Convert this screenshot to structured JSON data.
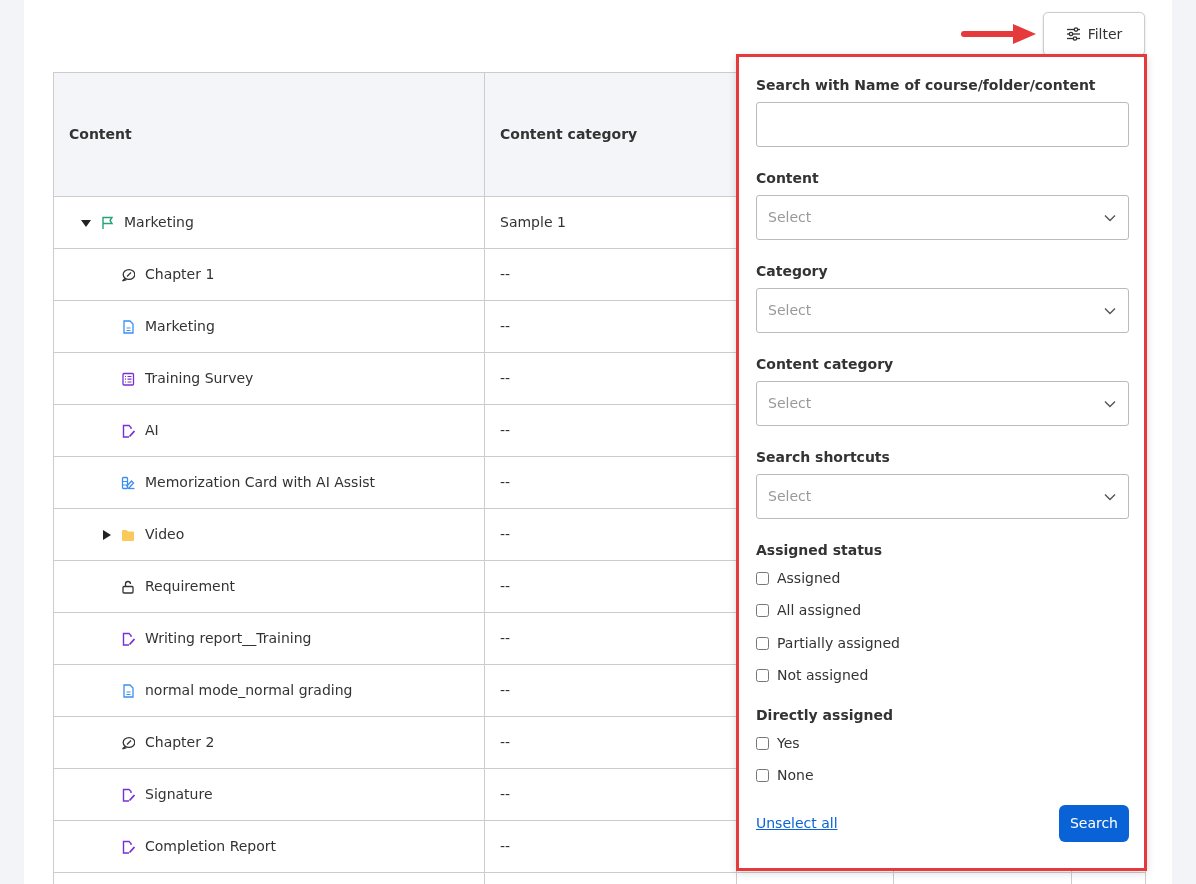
{
  "filter_button": {
    "label": "Filter"
  },
  "table": {
    "columns": [
      "Content",
      "Content category"
    ],
    "rows": [
      {
        "name": "Marketing",
        "kind": "course",
        "category": "Sample 1",
        "expanded": true,
        "children": [
          {
            "name": "Chapter 1",
            "kind": "chapter",
            "category": "--"
          },
          {
            "name": "Marketing",
            "kind": "document",
            "category": "--"
          },
          {
            "name": "Training Survey",
            "kind": "survey",
            "category": "--"
          },
          {
            "name": "AI",
            "kind": "report",
            "category": "--"
          },
          {
            "name": "Memorization Card with AI Assist",
            "kind": "card",
            "category": "--"
          },
          {
            "name": "Video",
            "kind": "folder",
            "category": "--",
            "expanded": false
          },
          {
            "name": "Requirement",
            "kind": "requirement",
            "category": "--"
          },
          {
            "name": "Writing report__Training",
            "kind": "report",
            "category": "--"
          },
          {
            "name": "normal mode_normal grading",
            "kind": "document",
            "category": "--"
          },
          {
            "name": "Chapter 2",
            "kind": "chapter",
            "category": "--"
          },
          {
            "name": "Signature",
            "kind": "report",
            "category": "--"
          },
          {
            "name": "Completion Report",
            "kind": "report",
            "category": "--"
          }
        ]
      }
    ]
  },
  "filter_panel": {
    "fields": [
      {
        "kind": "text",
        "label": "Search with Name of course/folder/content"
      },
      {
        "kind": "select",
        "label": "Content",
        "placeholder": "Select"
      },
      {
        "kind": "select",
        "label": "Category",
        "placeholder": "Select"
      },
      {
        "kind": "select",
        "label": "Content category",
        "placeholder": "Select"
      },
      {
        "kind": "select",
        "label": "Search shortcuts",
        "placeholder": "Select"
      }
    ],
    "checkbox_groups": [
      {
        "title": "Assigned status",
        "options": [
          {
            "label": "Assigned",
            "checked": false
          },
          {
            "label": "All assigned",
            "checked": false
          },
          {
            "label": "Partially assigned",
            "checked": false
          },
          {
            "label": "Not assigned",
            "checked": false
          }
        ]
      },
      {
        "title": "Directly assigned",
        "options": [
          {
            "label": "Yes",
            "checked": false
          },
          {
            "label": "None",
            "checked": false
          }
        ]
      }
    ],
    "unselect_link": "Unselect all",
    "search_button": "Search"
  }
}
